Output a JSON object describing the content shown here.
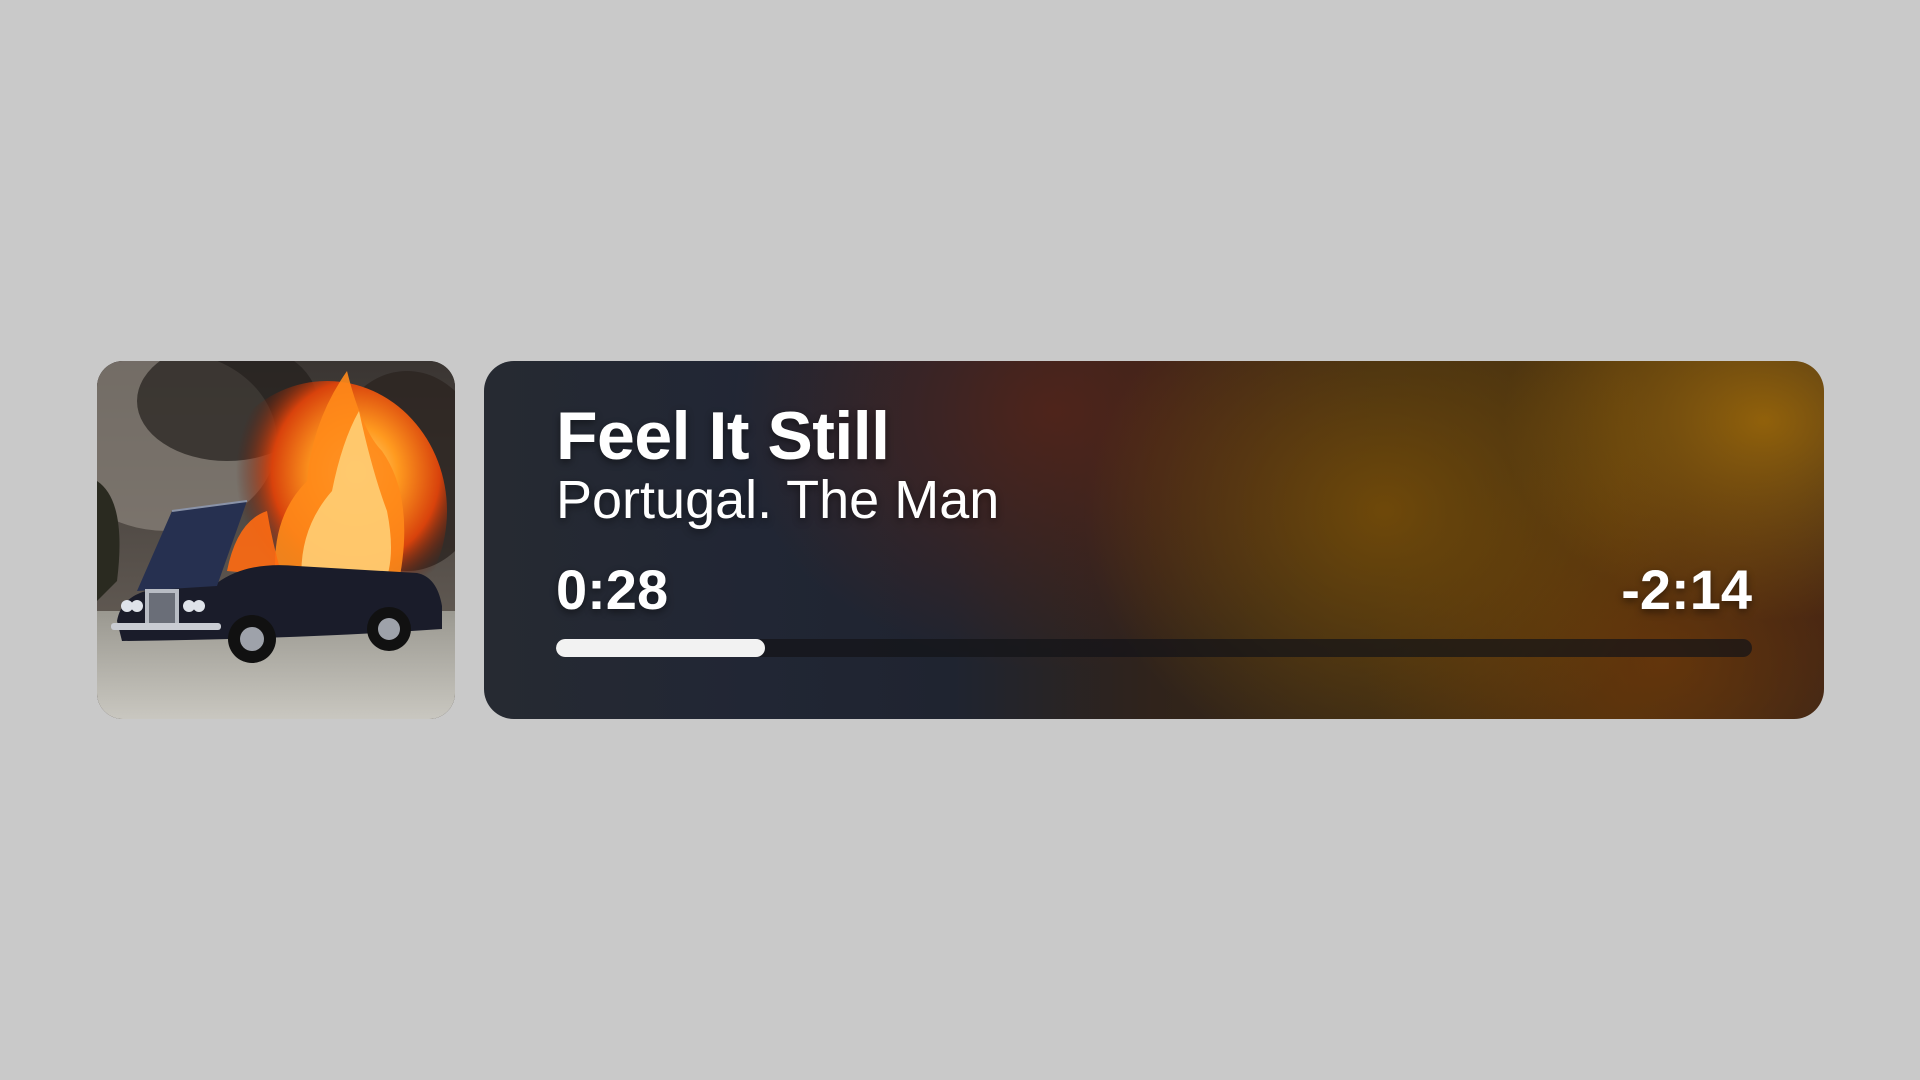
{
  "album_art": {
    "alt": "Album cover: a vintage car on fire with its hood open"
  },
  "now_playing": {
    "title": "Feel It Still",
    "artist": "Portugal. The Man",
    "elapsed": "0:28",
    "remaining": "-2:14",
    "progress_fraction": 0.175
  },
  "colors": {
    "background": "#c9c9c9",
    "text": "#ffffff",
    "progress_fill": "#f2f2f2",
    "card_accent": "#8a5e0a"
  }
}
